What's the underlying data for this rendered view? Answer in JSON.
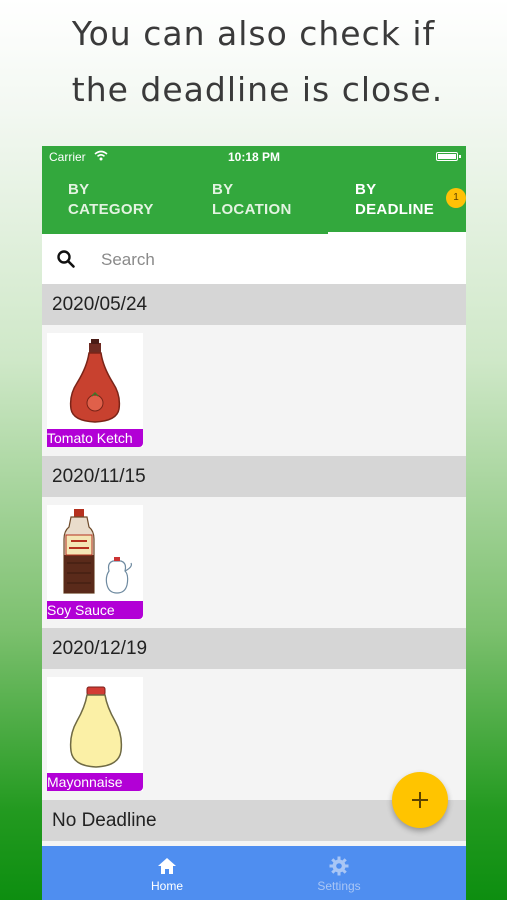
{
  "promo": {
    "line1": "You can also check if",
    "line2": "the deadline is close."
  },
  "status_bar": {
    "carrier": "Carrier",
    "time": "10:18 PM"
  },
  "tabs": [
    {
      "label": "BY\nCATEGORY",
      "active": false
    },
    {
      "label": "BY\nLOCATION",
      "active": false
    },
    {
      "label": "BY\nDEADLINE",
      "active": true
    }
  ],
  "tab_badge": "1",
  "search": {
    "placeholder": "Search",
    "value": ""
  },
  "sections": [
    {
      "date": "2020/05/24",
      "items": [
        {
          "name": "Tomato Ketch",
          "icon": "ketchup-bottle-icon"
        }
      ]
    },
    {
      "date": "2020/11/15",
      "items": [
        {
          "name": "Soy Sauce",
          "icon": "soy-sauce-bottle-icon"
        }
      ]
    },
    {
      "date": "2020/12/19",
      "items": [
        {
          "name": "Mayonnaise",
          "icon": "mayonnaise-bottle-icon"
        }
      ]
    },
    {
      "date": "No Deadline",
      "items": []
    }
  ],
  "fab": {
    "icon": "plus-icon"
  },
  "bottom_nav": [
    {
      "label": "Home",
      "icon": "home-icon",
      "active": true
    },
    {
      "label": "Settings",
      "icon": "gear-icon",
      "active": false
    }
  ],
  "colors": {
    "app_bar": "#33a83d",
    "badge": "#ffc107",
    "item_label": "#b200d6",
    "fab": "#ffc400",
    "bottom_nav": "#4f8ef0"
  }
}
